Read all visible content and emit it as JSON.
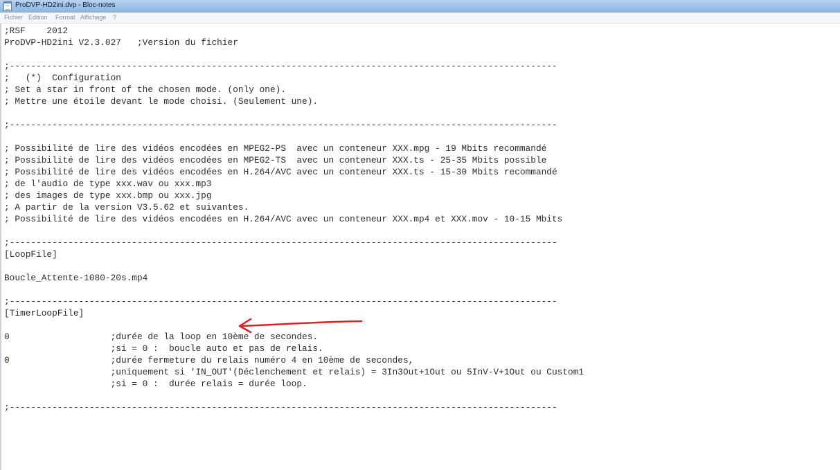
{
  "window": {
    "title": "ProDVP-HD2ini.dvp - Bloc-notes"
  },
  "menu": {
    "items": [
      "Fichier",
      "Edition",
      "Format",
      "Affichage",
      "?"
    ]
  },
  "editor": {
    "lines": [
      ";RSF    2012",
      "ProDVP-HD2ini V2.3.027   ;Version du fichier",
      "",
      ";-------------------------------------------------------------------------------------------------------",
      ";   (*)  Configuration",
      "; Set a star in front of the chosen mode. (only one).",
      "; Mettre une étoile devant le mode choisi. (Seulement une).",
      "",
      ";-------------------------------------------------------------------------------------------------------",
      "",
      "; Possibilité de lire des vidéos encodées en MPEG2-PS  avec un conteneur XXX.mpg - 19 Mbits recommandé",
      "; Possibilité de lire des vidéos encodées en MPEG2-TS  avec un conteneur XXX.ts - 25-35 Mbits possible",
      "; Possibilité de lire des vidéos encodées en H.264/AVC avec un conteneur XXX.ts - 15-30 Mbits recommandé",
      "; de l'audio de type xxx.wav ou xxx.mp3",
      "; des images de type xxx.bmp ou xxx.jpg",
      "; A partir de la version V3.5.62 et suivantes.",
      "; Possibilité de lire des vidéos encodées en H.264/AVC avec un conteneur XXX.mp4 et XXX.mov - 10-15 Mbits",
      "",
      ";-------------------------------------------------------------------------------------------------------",
      "[LoopFile]",
      "",
      "Boucle_Attente-1080-20s.mp4",
      "",
      ";-------------------------------------------------------------------------------------------------------",
      "[TimerLoopFile]",
      "",
      "0                   ;durée de la loop en 10ème de secondes.",
      "                    ;si = 0 :  boucle auto et pas de relais.",
      "0                   ;durée fermeture du relais numéro 4 en 10ème de secondes,",
      "                    ;uniquement si 'IN_OUT'(Déclenchement et relais) = 3In3Out+1Out ou 5InV-V+1Out ou Custom1",
      "                    ;si = 0 :  durée relais = durée loop.",
      "",
      ";-------------------------------------------------------------------------------------------------------"
    ]
  },
  "annotation": {
    "arrow_color": "#e02020"
  }
}
